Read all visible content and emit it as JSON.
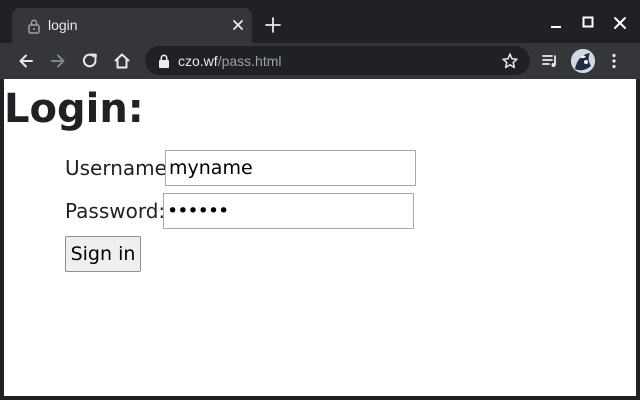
{
  "tab": {
    "title": "login",
    "lock_icon": "lock-icon",
    "close_icon": "close-icon"
  },
  "new_tab_icon": "plus-icon",
  "window_controls": [
    "minimize-icon",
    "maximize-icon",
    "close-icon"
  ],
  "toolbar": {
    "icons": [
      "back-arrow-icon",
      "forward-arrow-icon",
      "reload-icon",
      "home-icon"
    ],
    "url_host": "czo.wf",
    "url_path": "/pass.html",
    "right_icons": [
      "bookmark-star-icon",
      "reading-list-icon",
      "profile-avatar",
      "menu-kebab-icon"
    ]
  },
  "page": {
    "title": "Login:",
    "username_label": "Username:",
    "username_value": "myname",
    "password_label": "Password:",
    "password_value": "••••••",
    "signin_label": "Sign in"
  },
  "colors": {
    "chrome_dark": "#202124",
    "chrome_toolbar": "#35363a",
    "page_bg": "#ffffff",
    "text": "#202124"
  }
}
